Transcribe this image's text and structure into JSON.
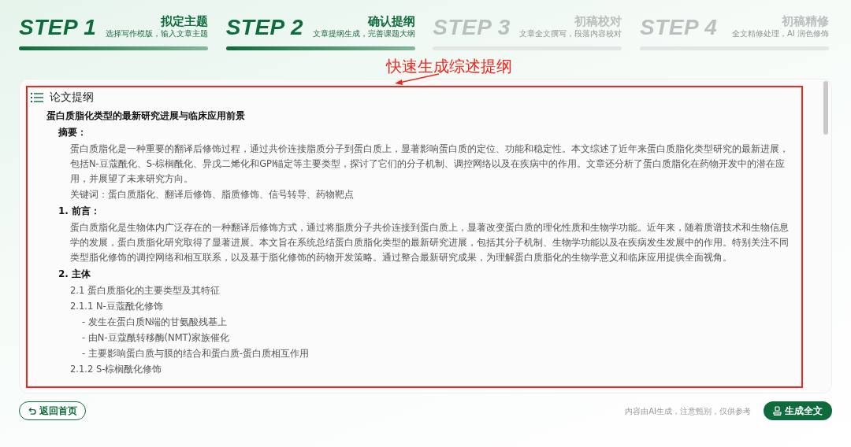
{
  "steps": [
    {
      "label": "STEP 1",
      "title": "拟定主题",
      "subtitle": "选择写作模版，输入文章主题",
      "completed": true
    },
    {
      "label": "STEP 2",
      "title": "确认提纲",
      "subtitle": "文章提纲生成，完善课题大纲",
      "completed": true
    },
    {
      "label": "STEP 3",
      "title": "初稿校对",
      "subtitle": "文章全文撰写，段落内容校对",
      "completed": false
    },
    {
      "label": "STEP 4",
      "title": "初稿精修",
      "subtitle": "全文精修处理，AI 润色修饰",
      "completed": false
    }
  ],
  "annotation": {
    "text": "快速生成综述提纲"
  },
  "outline": {
    "heading": "论文提纲",
    "title": "蛋白质脂化类型的最新研究进展与临床应用前景",
    "items": [
      {
        "kind": "section",
        "text": "摘要：",
        "children": [
          {
            "kind": "paragraph",
            "text": "蛋白质脂化是一种重要的翻译后修饰过程，通过共价连接脂质分子到蛋白质上，显著影响蛋白质的定位、功能和稳定性。本文综述了近年来蛋白质脂化类型研究的最新进展，包括N-豆蔻酰化、S-棕榈酰化、异戊二烯化和GPI锚定等主要类型，探讨了它们的分子机制、调控网络以及在疾病中的作用。文章还分析了蛋白质脂化在药物开发中的潜在应用，并展望了未来研究方向。"
          },
          {
            "kind": "paragraph",
            "text": "关键词：蛋白质脂化、翻译后修饰、脂质修饰、信号转导、药物靶点"
          }
        ]
      },
      {
        "kind": "section",
        "text": "1. 前言：",
        "children": [
          {
            "kind": "paragraph",
            "text": "蛋白质脂化是生物体内广泛存在的一种翻译后修饰方式，通过将脂质分子共价连接到蛋白质上，显著改变蛋白质的理化性质和生物学功能。近年来，随着质谱技术和生物信息学的发展，蛋白质脂化研究取得了显著进展。本文旨在系统总结蛋白质脂化类型的最新研究进展，包括其分子机制、生物学功能以及在疾病发生发展中的作用。特别关注不同类型脂化修饰的调控网络和相互联系，以及基于脂化修饰的药物开发策略。通过整合最新研究成果，为理解蛋白质脂化的生物学意义和临床应用提供全面视角。"
          }
        ]
      },
      {
        "kind": "section",
        "text": "2. 主体",
        "children": [
          {
            "kind": "entry",
            "text": "2.1 蛋白质脂化的主要类型及其特征",
            "children": [
              {
                "kind": "entry",
                "text": "2.1.1 N-豆蔻酰化修饰",
                "children": [
                  {
                    "kind": "entry",
                    "text": "- 发生在蛋白质N端的甘氨酸残基上"
                  },
                  {
                    "kind": "entry",
                    "text": "- 由N-豆蔻酰转移酶(NMT)家族催化"
                  },
                  {
                    "kind": "entry",
                    "text": "- 主要影响蛋白质与膜的结合和蛋白质-蛋白质相互作用"
                  }
                ]
              },
              {
                "kind": "entry",
                "text": "2.1.2 S-棕榈酰化修饰"
              }
            ]
          }
        ]
      }
    ]
  },
  "footer": {
    "back_button": "返回首页",
    "note": "内容由AI生成，注意甄别，仅供参考",
    "generate_button": "生成全文"
  }
}
